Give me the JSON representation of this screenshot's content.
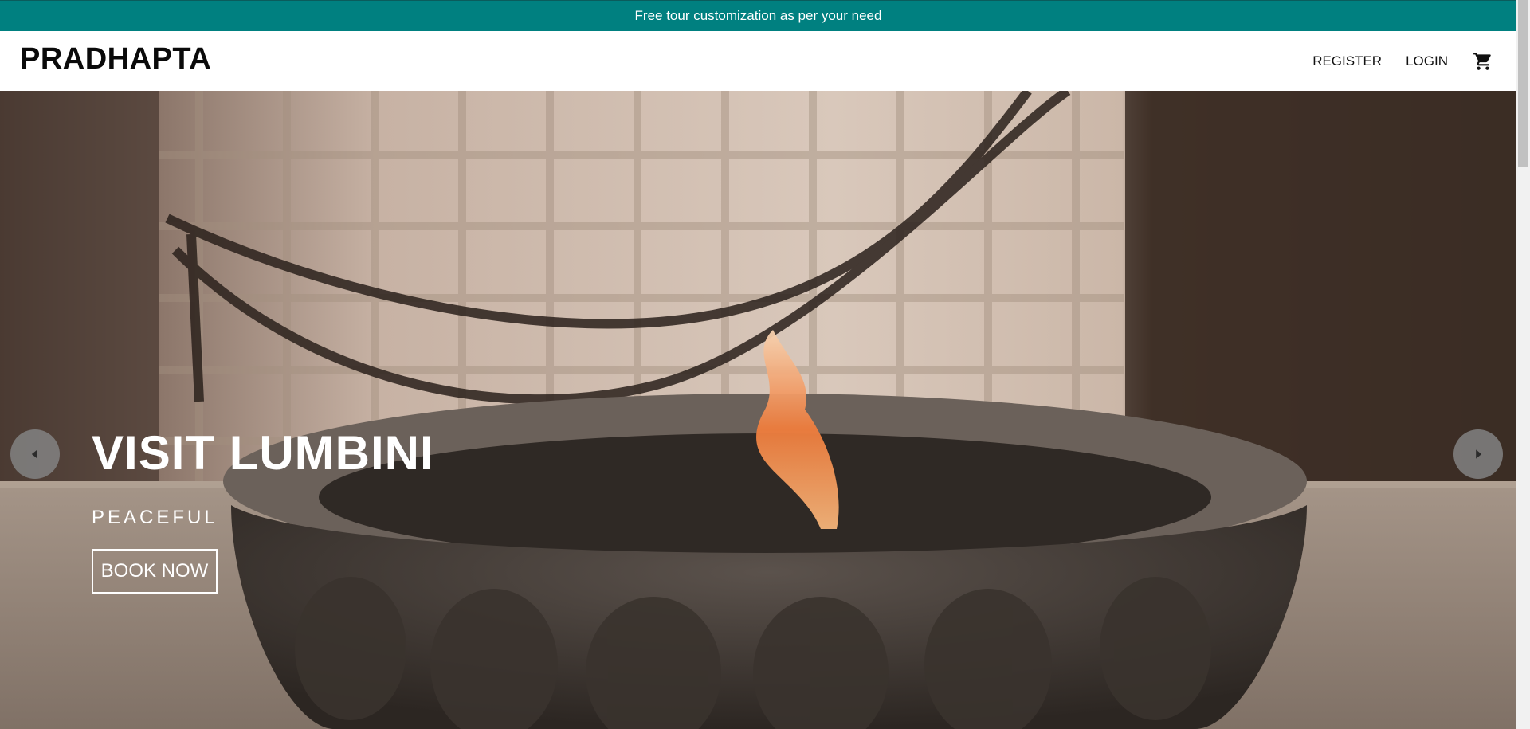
{
  "announcement": {
    "text": "Free tour customization as per your need",
    "bg_color": "#008080"
  },
  "navbar": {
    "logo": "PRADHAPTA",
    "links": {
      "register": "REGISTER",
      "login": "LOGIN"
    },
    "cart_icon": "shopping-cart-icon"
  },
  "hero": {
    "title": "VISIT LUMBINI",
    "subtitle": "PEACEFUL",
    "cta_label": "BOOK NOW",
    "prev_icon": "chevron-left-icon",
    "next_icon": "chevron-right-icon"
  }
}
